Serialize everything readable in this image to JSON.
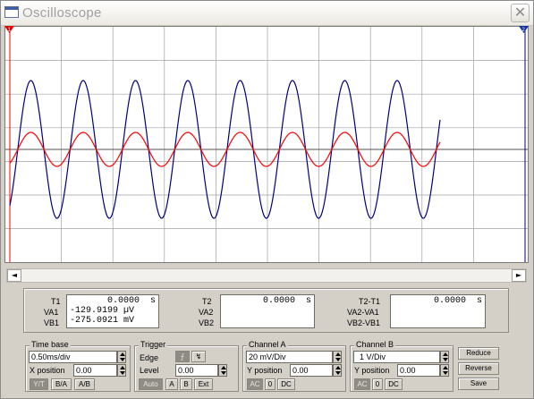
{
  "window": {
    "title": "Oscilloscope",
    "close_glyph": "✕"
  },
  "scope": {
    "trigger_marker_left": "1",
    "trigger_marker_right": "2",
    "colors": {
      "channel_a": "#ff0000",
      "channel_b": "#000080",
      "grid": "#a0a0a0",
      "cursor_left": "#ff0000"
    }
  },
  "scroll": {
    "left_glyph": "◄",
    "right_glyph": "►"
  },
  "measure": {
    "t1_label": "T1",
    "va1_label": "VA1",
    "vb1_label": "VB1",
    "t1_value": "0.0000  s",
    "va1_value": "-129.9199 µV",
    "vb1_value": "-275.0921 mV",
    "t2_label": "T2",
    "va2_label": "VA2",
    "vb2_label": "VB2",
    "t2_value": "0.0000  s",
    "dt_label": "T2-T1",
    "dva_label": "VA2-VA1",
    "dvb_label": "VB2-VB1",
    "dt_value": "0.0000  s"
  },
  "timebase": {
    "title": "Time base",
    "value": "0.50ms/div",
    "xpos_label": "X position",
    "xpos_value": "0.00",
    "modes": [
      "Y/T",
      "B/A",
      "A/B"
    ]
  },
  "trigger": {
    "title": "Trigger",
    "edge_label": "Edge",
    "level_label": "Level",
    "level_value": "0.00",
    "rise_glyph": "⨍",
    "fall_glyph": "↯",
    "modes": [
      "Auto",
      "A",
      "B",
      "Ext"
    ]
  },
  "channel_a": {
    "title": "Channel A",
    "value": "20 mV/Div",
    "ypos_label": "Y position",
    "ypos_value": "0.00",
    "coupling": [
      "AC",
      "0",
      "DC"
    ]
  },
  "channel_b": {
    "title": "Channel B",
    "value": "1 V/Div",
    "ypos_label": "Y position",
    "ypos_value": "0.00",
    "coupling": [
      "AC",
      "0",
      "DC"
    ]
  },
  "buttons": {
    "reduce": "Reduce",
    "reverse": "Reverse",
    "save": "Save"
  }
}
